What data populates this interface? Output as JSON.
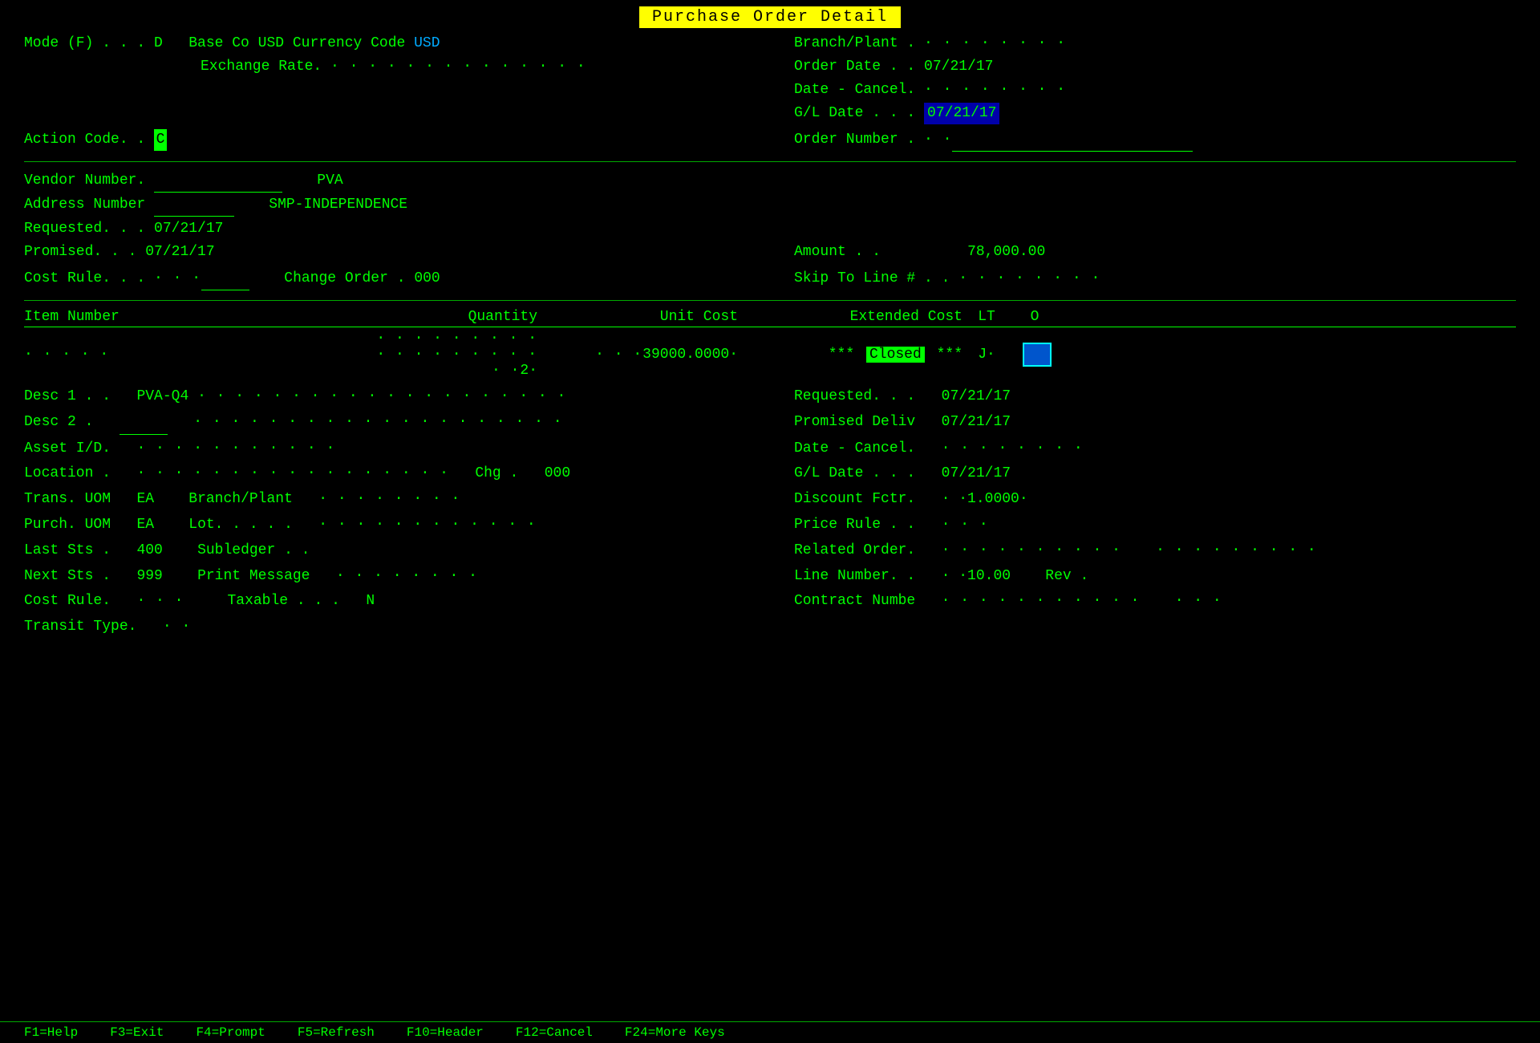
{
  "title": "Purchase Order Detail",
  "header": {
    "mode_label": "Mode (F) . . . D",
    "base_co_label": "Base Co",
    "currency_label": "USD Currency Code",
    "currency_value": "USD",
    "exchange_rate_label": "Exchange Rate.",
    "exchange_rate_dots": "· · · · · · · · · · · · · ·",
    "branch_plant_label": "Branch/Plant .",
    "branch_plant_dots": "· · · · · · · ·",
    "order_date_label": "Order Date . .",
    "order_date_value": "07/21/17",
    "date_cancel_label": "Date - Cancel.",
    "date_cancel_dots": "· · · · · · · ·",
    "gl_date_label": "G/L Date . . .",
    "gl_date_value": "07/21/17",
    "action_code_label": "Action Code. .",
    "action_code_value": "C",
    "order_number_label": "Order Number .",
    "order_number_dots": "· ·"
  },
  "vendor": {
    "vendor_number_label": "Vendor Number.",
    "vendor_dots": "_ _ _ _ _ _ _ _",
    "vendor_value": "PVA",
    "address_number_label": "Address Number",
    "address_dots": "_ _ _ _ _",
    "address_value": "SMP-INDEPENDENCE",
    "requested_label": "Requested. . .",
    "requested_value": "07/21/17",
    "promised_label": "Promised. . .",
    "promised_value": "07/21/17",
    "amount_label": "Amount . .",
    "amount_value": "78,000.00",
    "cost_rule_label": "Cost Rule. . .",
    "cost_rule_dots": "· · ·",
    "change_order_label": "Change Order .",
    "change_order_value": "000",
    "skip_to_line_label": "Skip To Line # . .",
    "skip_to_line_dots": "· · · · · · · ·"
  },
  "columns": {
    "item_number": "Item Number",
    "quantity": "Quantity",
    "unit_cost": "Unit Cost",
    "extended_cost": "Extended Cost",
    "lt": "LT",
    "o": "O"
  },
  "line_item": {
    "item_dots": "· · · · ·",
    "qty_dots": "· · · · · · · · · · · · · · · · · · · ·",
    "qty_value": "2·",
    "unit_cost_dots": "· · ·",
    "unit_cost_value": "39000.0000·",
    "extended_cost_prefix": "*** Closed ***",
    "lt_value": "J·",
    "o_indicator": "□"
  },
  "detail": {
    "desc1_label": "Desc 1 . .",
    "desc1_value": "PVA-Q4",
    "desc1_dots": "· · · · · · · · · · · · · · · · · · · ·",
    "requested_label": "Requested. . .",
    "requested_value": "07/21/17",
    "desc2_label": "Desc 2 .",
    "desc2_dots2": "_ _ _",
    "desc2_dots": "· · · · · · · · · · · · · · · · · · · ·",
    "promised_deliv_label": "Promised Deliv",
    "promised_deliv_value": "07/21/17",
    "asset_id_label": "Asset I/D.",
    "asset_id_dots": "· · · · · · · · · · ·",
    "date_cancel_label": "Date - Cancel.",
    "date_cancel_dots": "· · · · · · · ·",
    "location_label": "Location .",
    "location_dots": "· · · · · · · · · · · · · · · · ·",
    "chg_label": "Chg .",
    "chg_value": "000",
    "gl_date_label": "G/L Date . . .",
    "gl_date_value": "07/21/17",
    "trans_uom_label": "Trans. UOM",
    "trans_uom_value": "EA",
    "branch_plant_label": "Branch/Plant",
    "branch_plant_dots": "· · · · · · · ·",
    "discount_fctr_label": "Discount Fctr.",
    "discount_fctr_value": "· ·1.0000·",
    "purch_uom_label": "Purch. UOM",
    "purch_uom_value": "EA",
    "lot_label": "Lot. . . . .",
    "lot_dots": "· · · · · · · · · · · ·",
    "price_rule_label": "Price Rule . .",
    "price_rule_dots": "· · ·",
    "last_sts_label": "Last Sts .",
    "last_sts_value": "400",
    "subledger_label": "Subledger . .",
    "related_order_label": "Related Order.",
    "related_order_dots": "· · · · · · · · · ·",
    "related_order_dots2": "· · · · · · · · ·",
    "next_sts_label": "Next Sts .",
    "next_sts_value": "999",
    "print_message_label": "Print Message",
    "print_message_dots": "· · · · · · · ·",
    "line_number_label": "Line Number. .",
    "line_number_value": "· ·10.00",
    "rev_label": "Rev .",
    "cost_rule_label": "Cost Rule.",
    "cost_rule_dots": "· · ·",
    "taxable_label": "Taxable . . .",
    "taxable_value": "N",
    "contract_numbe_label": "Contract Numbe",
    "contract_dots1": "· · · · · · · · · · ·",
    "contract_dots2": "· · ·",
    "transit_type_label": "Transit Type.",
    "transit_type_dots": "· ·"
  },
  "footer": {
    "items": [
      "F1=Help",
      "F3=Exit",
      "F4=Prompt",
      "F5=Refresh",
      "F10=Header",
      "F12=Cancel",
      "F24=More Keys"
    ]
  }
}
